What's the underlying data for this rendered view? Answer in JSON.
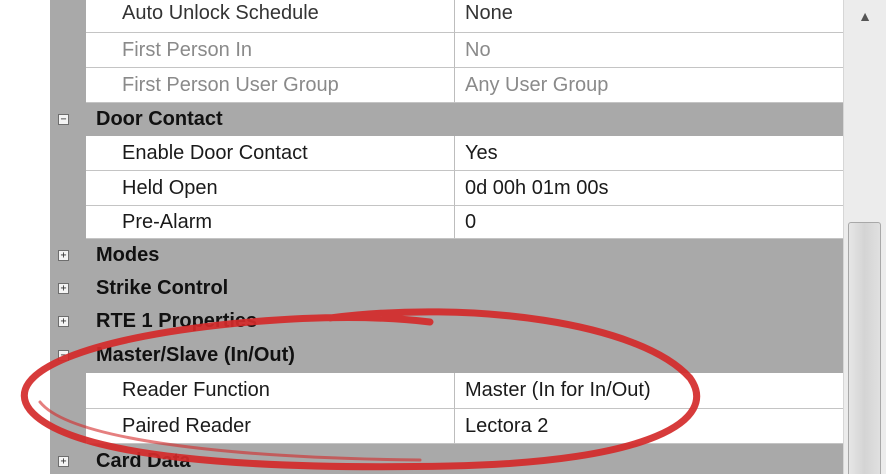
{
  "property_grid": {
    "rows": [
      {
        "name": "Auto Unlock Schedule",
        "value": "None"
      },
      {
        "name": "First Person In",
        "value": "No"
      },
      {
        "name": "First Person User Group",
        "value": "Any User Group"
      }
    ],
    "categories": {
      "door_contact": {
        "toggle": "−",
        "label": "Door Contact",
        "rows": [
          {
            "name": "Enable Door Contact",
            "value": "Yes"
          },
          {
            "name": "Held Open",
            "value": "0d 00h 01m 00s"
          },
          {
            "name": "Pre-Alarm",
            "value": "0"
          }
        ]
      },
      "modes": {
        "toggle": "+",
        "label": "Modes"
      },
      "strike_control": {
        "toggle": "+",
        "label": "Strike Control"
      },
      "rte1_properties": {
        "toggle": "+",
        "label": "RTE 1 Properties"
      },
      "master_slave": {
        "toggle": "−",
        "label": "Master/Slave (In/Out)",
        "rows": [
          {
            "name": "Reader Function",
            "value": "Master (In for In/Out)"
          },
          {
            "name": "Paired Reader",
            "value": "Lectora 2"
          }
        ]
      },
      "card_data": {
        "toggle": "+",
        "label": "Card Data"
      }
    }
  },
  "scrollbar": {
    "up_icon": "scroll-up-arrow-icon"
  },
  "annotation": {
    "shape": "hand-drawn-ellipse",
    "color": "#d42a2a"
  }
}
